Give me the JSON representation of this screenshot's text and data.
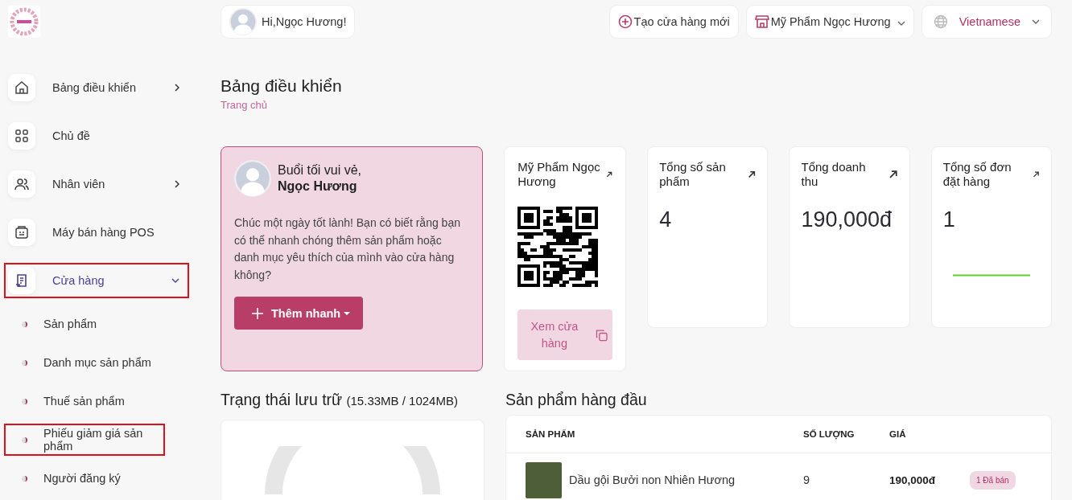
{
  "header": {
    "greeting": "Hi,Ngọc Hương!",
    "create_store": "Tạo cửa hàng mới",
    "store_name": "Mỹ Phẩm Ngọc Hương",
    "language": "Vietnamese"
  },
  "sidebar": {
    "items": [
      {
        "label": "Bảng điều khiển",
        "kind": "collapsed",
        "expanded": false,
        "highlighted": false
      },
      {
        "label": "Chủ đề",
        "kind": "plain",
        "expanded": false,
        "highlighted": false
      },
      {
        "label": "Nhân viên",
        "kind": "collapsed",
        "expanded": false,
        "highlighted": false
      },
      {
        "label": "Máy bán hàng POS",
        "kind": "plain",
        "expanded": false,
        "highlighted": false
      },
      {
        "label": "Cửa hàng",
        "kind": "collapsed",
        "expanded": true,
        "highlighted": true,
        "children": [
          {
            "label": "Sản phẩm",
            "highlighted": false
          },
          {
            "label": "Danh mục sản phẩm",
            "highlighted": false
          },
          {
            "label": "Thuế sản phẩm",
            "highlighted": false
          },
          {
            "label": "Phiếu giảm giá sản phẩm",
            "highlighted": true
          },
          {
            "label": "Người đăng ký",
            "highlighted": false
          }
        ]
      }
    ]
  },
  "page": {
    "title": "Bảng điều khiển",
    "breadcrumb": "Trang chủ"
  },
  "welcome": {
    "greeting": "Buổi tối vui vẻ,",
    "name": "Ngọc Hương",
    "message": "Chúc một ngày tốt lành! Bạn có biết rằng bạn có thể nhanh chóng thêm sản phẩm hoặc danh mục yêu thích của mình vào cửa hàng không?",
    "button": "Thêm nhanh"
  },
  "store_card": {
    "title": "Mỹ Phẩm Ngọc Hương",
    "button": "Xem cửa hàng"
  },
  "stats": [
    {
      "title": "Tổng số sản phẩm",
      "value": "4",
      "kind": "plain"
    },
    {
      "title": "Tổng doanh thu",
      "value": "190,000đ",
      "kind": "plain"
    },
    {
      "title": "Tổng số đơn đặt hàng",
      "value": "1",
      "kind": "sparkline"
    }
  ],
  "storage": {
    "title": "Trạng thái lưu trữ",
    "usage": "(15.33MB / 1024MB)"
  },
  "top_products": {
    "title": "Sản phẩm hàng đầu",
    "columns": [
      "SẢN PHẨM",
      "SỐ LƯỢNG",
      "GIÁ"
    ],
    "rows": [
      {
        "name": "Dầu gội Bưởi non Nhiên Hương",
        "quantity": "9",
        "price": "190,000đ",
        "badge": "1 Đã bán"
      }
    ]
  }
}
